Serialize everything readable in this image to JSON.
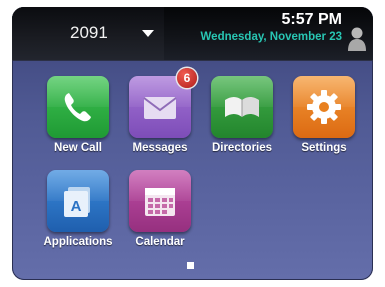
{
  "status_bar": {
    "line": "2091",
    "time": "5:57 PM",
    "date": "Wednesday, November 23"
  },
  "apps": [
    {
      "label": "New Call",
      "icon": "phone-icon",
      "color": "#2eae42"
    },
    {
      "label": "Messages",
      "icon": "envelope-icon",
      "color": "#8f5fc8",
      "badge": "6"
    },
    {
      "label": "Directories",
      "icon": "book-icon",
      "color": "#33a03c"
    },
    {
      "label": "Settings",
      "icon": "gear-icon",
      "color": "#e8801f"
    },
    {
      "label": "Applications",
      "icon": "applications-icon",
      "color": "#2a72c4"
    },
    {
      "label": "Calendar",
      "icon": "calendar-icon",
      "color": "#aa3f93"
    }
  ],
  "pager": {
    "pages": 1,
    "current": 1
  },
  "colors": {
    "status_bar_bg": "#0d0f14",
    "date_text": "#28c6b3",
    "screen_bg": "#505a94"
  }
}
